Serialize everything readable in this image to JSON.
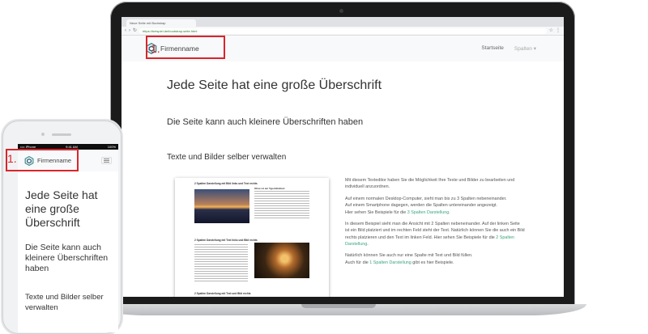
{
  "browser": {
    "tab_title": "Neue Seite mit Bootstrap",
    "url": "https://beispiel.de/bootstrap-seite.html"
  },
  "site": {
    "brand": "Firmenname",
    "nav": [
      "Startseite",
      "Spalten ▾"
    ],
    "headings": {
      "h1": "Jede Seite hat eine große Überschrift",
      "h2": "Die Seite kann auch kleinere Überschriften haben",
      "h3": "Texte und Bilder selber verwalten"
    },
    "paragraphs": {
      "p1": "Mit diesem Texteditor haben Sie die Möglichkeit Ihre Texte und Bilder zu bearbeiten und individuell anzuordnen.",
      "p2a": "Auf einem normalen Desktop-Computer, sieht man bis zu 3 Spalten nebeneinander.",
      "p2b": "Auf einem Smartphone dagegen, werden die Spalten untereinander angezeigt.",
      "p2c_pre": "Hier sehen Sie Beispiele für die ",
      "p2c_link": "3 Spalten Darstellung",
      "p2c_post": ".",
      "p3_pre": "In diesem Beispiel sieht man die Ansicht mit 2 Spalten nebeneinander. Auf der linken Seite ist ein Bild platziert und im rechten Feld steht der Text. Natürlich können Sie die auch ein Bild rechts platzieren und den Text im linken Feld. Hier sehen Sie Beispiele für die ",
      "p3_link": "2 Spalten Darstellung",
      "p3_post": ".",
      "p4a": "Natürlich können Sie auch nur eine Spalte mit Text und Bild füllen.",
      "p4b_pre": "Auch für die ",
      "p4b_link": "1 Spalten Darstellung",
      "p4b_post": " gibt es hier Beispiele."
    },
    "document_preview": {
      "heading1": "2 Spalten Darstellung mit Bild links und Text rechts",
      "heading2": "2 Spalten Darstellung mit Text links und Bild rechts",
      "heading3": "2 Spalten Darstellung mit Text und Bild rechts",
      "subheading": "Ohne ist ein Typoblindtext"
    }
  },
  "phone": {
    "status": {
      "carrier": "•••• iPhone",
      "time": "9:41 AM",
      "battery": "100%"
    },
    "brand": "Firmenname",
    "headings": {
      "h1": "Jede Seite hat eine große Überschrift",
      "h2": "Die Seite kann auch kleinere Überschriften haben",
      "h3": "Texte und Bilder selber verwalten"
    }
  },
  "annotations": {
    "marker_label": "1."
  },
  "colors": {
    "marker": "#d9252b",
    "link": "#3aa57d",
    "navbar": "#f8f9fa"
  }
}
